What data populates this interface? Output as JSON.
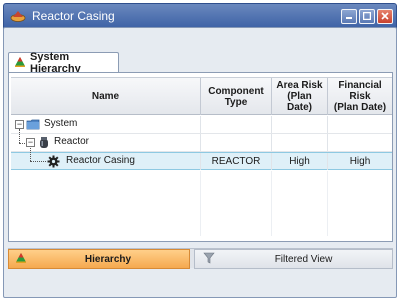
{
  "window": {
    "title": "Reactor Casing"
  },
  "tab": {
    "label": "System Hierarchy"
  },
  "grid": {
    "columns": [
      {
        "label": "Name"
      },
      {
        "label": "Component\nType"
      },
      {
        "label": "Area Risk\n(Plan\nDate)"
      },
      {
        "label": "Financial\nRisk\n(Plan Date)"
      }
    ],
    "rows": [
      {
        "name": "System",
        "component_type": "",
        "area_risk": "",
        "financial_risk": ""
      },
      {
        "name": "Reactor",
        "component_type": "",
        "area_risk": "",
        "financial_risk": ""
      },
      {
        "name": "Reactor Casing",
        "component_type": "REACTOR",
        "area_risk": "High",
        "financial_risk": "High"
      }
    ]
  },
  "bottom_tabs": {
    "hierarchy": "Hierarchy",
    "filtered_view": "Filtered View"
  },
  "icons": {
    "app": "hierarchy-triangle-icon",
    "folder": "folder-icon",
    "reactor": "reactor-icon",
    "gear": "gear-icon",
    "filter": "funnel-icon"
  },
  "colors": {
    "titlebar": "#3d62a6",
    "active_tab": "#f5a94f",
    "selected_row": "#dff0f8"
  }
}
